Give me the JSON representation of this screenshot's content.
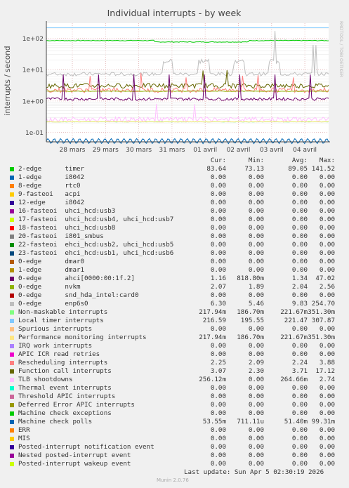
{
  "chart_data": {
    "type": "line",
    "title": "Individual interrupts - by week",
    "ylabel": "interrupts / second",
    "yscale": "log",
    "ylim": [
      0.05,
      300
    ],
    "y_ticks": [
      "1e-01",
      "1e+00",
      "1e+01",
      "1e+02"
    ],
    "x_ticks": [
      "28 mars",
      "29 mars",
      "30 mars",
      "31 mars",
      "01 avril",
      "02 avril",
      "03 avril",
      "04 avril"
    ],
    "grid": true,
    "watermark": "RRDTOOL / TOBI OETIKER",
    "columns": [
      "Cur:",
      "Min:",
      "Avg:",
      "Max:"
    ],
    "series": [
      {
        "name": "2-edge",
        "desc": "timer",
        "color": "#00cc00",
        "values": [
          "83.64",
          "73.13",
          "89.05",
          "141.52"
        ]
      },
      {
        "name": "1-edge",
        "desc": "i8042",
        "color": "#0066b3",
        "values": [
          "0.00",
          "0.00",
          "0.00",
          "0.00"
        ]
      },
      {
        "name": "8-edge",
        "desc": "rtc0",
        "color": "#ff8000",
        "values": [
          "0.00",
          "0.00",
          "0.00",
          "0.00"
        ]
      },
      {
        "name": "9-fasteoi",
        "desc": "acpi",
        "color": "#ffcc00",
        "values": [
          "0.00",
          "0.00",
          "0.00",
          "0.00"
        ]
      },
      {
        "name": "12-edge",
        "desc": "i8042",
        "color": "#330099",
        "values": [
          "0.00",
          "0.00",
          "0.00",
          "0.00"
        ]
      },
      {
        "name": "16-fasteoi",
        "desc": "uhci_hcd:usb3",
        "color": "#990099",
        "values": [
          "0.00",
          "0.00",
          "0.00",
          "0.00"
        ]
      },
      {
        "name": "17-fasteoi",
        "desc": "uhci_hcd:usb4, uhci_hcd:usb7",
        "color": "#ccff00",
        "values": [
          "0.00",
          "0.00",
          "0.00",
          "0.00"
        ]
      },
      {
        "name": "18-fasteoi",
        "desc": "uhci_hcd:usb8",
        "color": "#ff0000",
        "values": [
          "0.00",
          "0.00",
          "0.00",
          "0.00"
        ]
      },
      {
        "name": "20-fasteoi",
        "desc": "i801_smbus",
        "color": "#808080",
        "values": [
          "0.00",
          "0.00",
          "0.00",
          "0.00"
        ]
      },
      {
        "name": "22-fasteoi",
        "desc": "ehci_hcd:usb2, uhci_hcd:usb5",
        "color": "#008f00",
        "values": [
          "0.00",
          "0.00",
          "0.00",
          "0.00"
        ]
      },
      {
        "name": "23-fasteoi",
        "desc": "ehci_hcd:usb1, uhci_hcd:usb6",
        "color": "#00487d",
        "values": [
          "0.00",
          "0.00",
          "0.00",
          "0.00"
        ]
      },
      {
        "name": "0-edge",
        "desc": "dmar0",
        "color": "#b35a00",
        "values": [
          "0.00",
          "0.00",
          "0.00",
          "0.00"
        ]
      },
      {
        "name": "1-edge",
        "desc": "dmar1",
        "color": "#b38f00",
        "values": [
          "0.00",
          "0.00",
          "0.00",
          "0.00"
        ]
      },
      {
        "name": "0-edge",
        "desc": "ahci[0000:00:1f.2]",
        "color": "#6b006b",
        "values": [
          "1.16",
          "818.80m",
          "1.34",
          "47.02"
        ]
      },
      {
        "name": "0-edge",
        "desc": "nvkm",
        "color": "#8fb300",
        "values": [
          "2.07",
          "1.89",
          "2.04",
          "2.56"
        ]
      },
      {
        "name": "0-edge",
        "desc": "snd_hda_intel:card0",
        "color": "#b30000",
        "values": [
          "0.00",
          "0.00",
          "0.00",
          "0.00"
        ]
      },
      {
        "name": "0-edge",
        "desc": "enp6s0",
        "color": "#bebebe",
        "values": [
          "6.30",
          "5.46",
          "9.83",
          "254.70"
        ]
      },
      {
        "name": "Non-maskable interrupts",
        "desc": "",
        "color": "#80ff80",
        "values": [
          "217.94m",
          "186.70m",
          "221.67m",
          "351.30m"
        ]
      },
      {
        "name": "Local timer interrupts",
        "desc": "",
        "color": "#80c9ff",
        "values": [
          "216.59",
          "195.55",
          "221.47",
          "307.87"
        ]
      },
      {
        "name": "Spurious interrupts",
        "desc": "",
        "color": "#ffc080",
        "values": [
          "0.00",
          "0.00",
          "0.00",
          "0.00"
        ]
      },
      {
        "name": "Performance monitoring interrupts",
        "desc": "",
        "color": "#ffe680",
        "values": [
          "217.94m",
          "186.70m",
          "221.67m",
          "351.30m"
        ]
      },
      {
        "name": "IRQ work interrupts",
        "desc": "",
        "color": "#aa80ff",
        "values": [
          "0.00",
          "0.00",
          "0.00",
          "0.00"
        ]
      },
      {
        "name": "APIC ICR read retries",
        "desc": "",
        "color": "#ee00cc",
        "values": [
          "0.00",
          "0.00",
          "0.00",
          "0.00"
        ]
      },
      {
        "name": "Rescheduling interrupts",
        "desc": "",
        "color": "#ff8080",
        "values": [
          "2.25",
          "2.09",
          "2.24",
          "3.88"
        ]
      },
      {
        "name": "Function call interrupts",
        "desc": "",
        "color": "#666600",
        "values": [
          "3.07",
          "2.30",
          "3.71",
          "17.12"
        ]
      },
      {
        "name": "TLB shootdowns",
        "desc": "",
        "color": "#ffbfff",
        "values": [
          "256.12m",
          "0.00",
          "264.66m",
          "2.74"
        ]
      },
      {
        "name": "Thermal event interrupts",
        "desc": "",
        "color": "#00ffcc",
        "values": [
          "0.00",
          "0.00",
          "0.00",
          "0.00"
        ]
      },
      {
        "name": "Threshold APIC interrupts",
        "desc": "",
        "color": "#cc6699",
        "values": [
          "0.00",
          "0.00",
          "0.00",
          "0.00"
        ]
      },
      {
        "name": "Deferred Error APIC interrupts",
        "desc": "",
        "color": "#999900",
        "values": [
          "0.00",
          "0.00",
          "0.00",
          "0.00"
        ]
      },
      {
        "name": "Machine check exceptions",
        "desc": "",
        "color": "#00cc00",
        "values": [
          "0.00",
          "0.00",
          "0.00",
          "0.00"
        ]
      },
      {
        "name": "Machine check polls",
        "desc": "",
        "color": "#0066b3",
        "values": [
          "53.55m",
          "711.11u",
          "51.40m",
          "99.31m"
        ]
      },
      {
        "name": "ERR",
        "desc": "",
        "color": "#ff8000",
        "values": [
          "0.00",
          "0.00",
          "0.00",
          "0.00"
        ]
      },
      {
        "name": "MIS",
        "desc": "",
        "color": "#ffcc00",
        "values": [
          "0.00",
          "0.00",
          "0.00",
          "0.00"
        ]
      },
      {
        "name": "Posted-interrupt notification event",
        "desc": "",
        "color": "#330099",
        "values": [
          "0.00",
          "0.00",
          "0.00",
          "0.00"
        ]
      },
      {
        "name": "Nested posted-interrupt event",
        "desc": "",
        "color": "#990099",
        "values": [
          "0.00",
          "0.00",
          "0.00",
          "0.00"
        ]
      },
      {
        "name": "Posted-interrupt wakeup event",
        "desc": "",
        "color": "#ccff00",
        "values": [
          "0.00",
          "0.00",
          "0.00",
          "0.00"
        ]
      }
    ],
    "plotted": [
      {
        "label": "Local timer interrupts",
        "color": "#80c9ff",
        "level": 216
      },
      {
        "label": "2-edge",
        "color": "#00cc00",
        "level": 84,
        "pattern": "step"
      },
      {
        "label": "0-edge",
        "color": "#bebebe",
        "level": 6.3,
        "pattern": "bursty"
      },
      {
        "label": "Function call interrupts",
        "color": "#666600",
        "level": 3.1,
        "pattern": "noise"
      },
      {
        "label": "Rescheduling interrupts",
        "color": "#ff8080",
        "level": 2.25,
        "pattern": "noise"
      },
      {
        "label": "0-edge",
        "color": "#8fb300",
        "level": 2.05,
        "pattern": "flat"
      },
      {
        "label": "0-edge",
        "color": "#6b006b",
        "level": 1.16,
        "pattern": "spiky"
      },
      {
        "label": "TLB shootdowns",
        "color": "#ffbfff",
        "level": 0.26,
        "pattern": "noise"
      },
      {
        "label": "Non-maskable interrupts",
        "color": "#80ff80",
        "level": 0.218,
        "pattern": "flat"
      },
      {
        "label": "Performance monitoring interrupts",
        "color": "#ffe680",
        "level": 0.218,
        "pattern": "flat"
      },
      {
        "label": "Machine check polls",
        "color": "#0066b3",
        "level": 0.0536,
        "pattern": "wave"
      }
    ]
  },
  "footer": {
    "last_update": "Last update:  Sun Apr  5 02:30:19 2026",
    "version": "Munin 2.0.76"
  }
}
